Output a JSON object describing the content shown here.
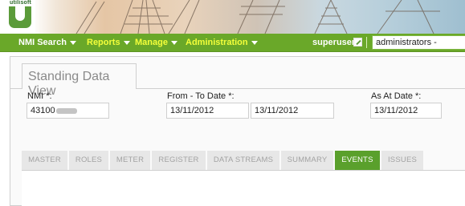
{
  "app": {
    "logo_text": "utilisoft"
  },
  "nav": {
    "items": [
      {
        "label": "NMI Search"
      },
      {
        "label": "Reports"
      },
      {
        "label": "Manage"
      },
      {
        "label": "Administration"
      }
    ],
    "user": "superuser",
    "role_select": "administrators -"
  },
  "view": {
    "title": "Standing Data View",
    "nmi_label": "NMI *:",
    "nmi_value": "43100",
    "from_to_label": "From - To Date *:",
    "from_date": "13/11/2012",
    "to_date": "13/11/2012",
    "as_at_label": "As At Date *:",
    "as_at_date": "13/11/2012"
  },
  "tabs": [
    {
      "label": "MASTER"
    },
    {
      "label": "ROLES"
    },
    {
      "label": "METER"
    },
    {
      "label": "REGISTER"
    },
    {
      "label": "DATA STREAMS"
    },
    {
      "label": "SUMMARY"
    },
    {
      "label": "EVENTS",
      "active": true
    },
    {
      "label": "ISSUES"
    }
  ],
  "colors": {
    "nav_green": "#6aa829",
    "active_tab": "#5aa02c",
    "nav_highlight": "#f4ff3a"
  }
}
